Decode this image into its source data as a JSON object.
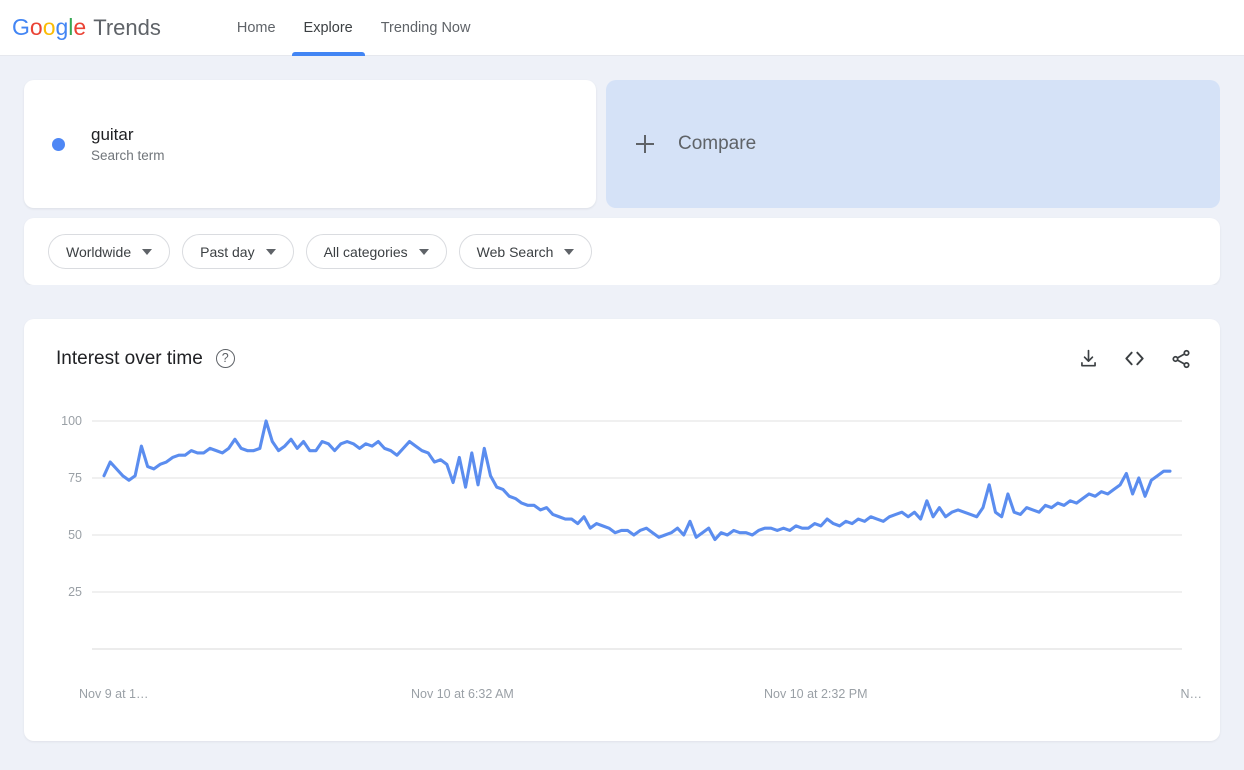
{
  "header": {
    "logo_word": "Google",
    "product": "Trends",
    "nav": [
      {
        "label": "Home",
        "active": false
      },
      {
        "label": "Explore",
        "active": true
      },
      {
        "label": "Trending Now",
        "active": false
      }
    ]
  },
  "search_term": {
    "term": "guitar",
    "type_label": "Search term",
    "dot_color": "#4e87f5"
  },
  "compare": {
    "label": "Compare",
    "icon": "plus-icon",
    "background": "#d5e2f7"
  },
  "filters": [
    {
      "label": "Worldwide"
    },
    {
      "label": "Past day"
    },
    {
      "label": "All categories"
    },
    {
      "label": "Web Search"
    }
  ],
  "chart_panel": {
    "title": "Interest over time",
    "help_glyph": "?",
    "actions": [
      {
        "name": "download-icon"
      },
      {
        "name": "embed-icon"
      },
      {
        "name": "share-icon"
      }
    ]
  },
  "chart_data": {
    "type": "line",
    "title": "Interest over time",
    "xlabel": "",
    "ylabel": "",
    "ylim": [
      0,
      100
    ],
    "yticks": [
      100,
      75,
      50,
      25
    ],
    "grid": true,
    "legend": false,
    "line_color": "#5b8def",
    "xticks": [
      "Nov 9 at 1…",
      "Nov 10 at 6:32 AM",
      "Nov 10 at 2:32 PM",
      "N…"
    ],
    "series": [
      {
        "name": "guitar",
        "values": [
          76,
          82,
          79,
          76,
          74,
          76,
          89,
          80,
          79,
          81,
          82,
          84,
          85,
          85,
          87,
          86,
          86,
          88,
          87,
          86,
          88,
          92,
          88,
          87,
          87,
          88,
          100,
          91,
          87,
          89,
          92,
          88,
          91,
          87,
          87,
          91,
          90,
          87,
          90,
          91,
          90,
          88,
          90,
          89,
          91,
          88,
          87,
          85,
          88,
          91,
          89,
          87,
          86,
          82,
          83,
          81,
          73,
          84,
          71,
          86,
          72,
          88,
          76,
          71,
          70,
          67,
          66,
          64,
          63,
          63,
          61,
          62,
          59,
          58,
          57,
          57,
          55,
          58,
          53,
          55,
          54,
          53,
          51,
          52,
          52,
          50,
          52,
          53,
          51,
          49,
          50,
          51,
          53,
          50,
          56,
          49,
          51,
          53,
          48,
          51,
          50,
          52,
          51,
          51,
          50,
          52,
          53,
          53,
          52,
          53,
          52,
          54,
          53,
          53,
          55,
          54,
          57,
          55,
          54,
          56,
          55,
          57,
          56,
          58,
          57,
          56,
          58,
          59,
          60,
          58,
          60,
          57,
          65,
          58,
          62,
          58,
          60,
          61,
          60,
          59,
          58,
          62,
          72,
          60,
          58,
          68,
          60,
          59,
          62,
          61,
          60,
          63,
          62,
          64,
          63,
          65,
          64,
          66,
          68,
          67,
          69,
          68,
          70,
          72,
          77,
          68,
          75,
          67,
          74,
          76,
          78,
          78
        ]
      }
    ]
  }
}
